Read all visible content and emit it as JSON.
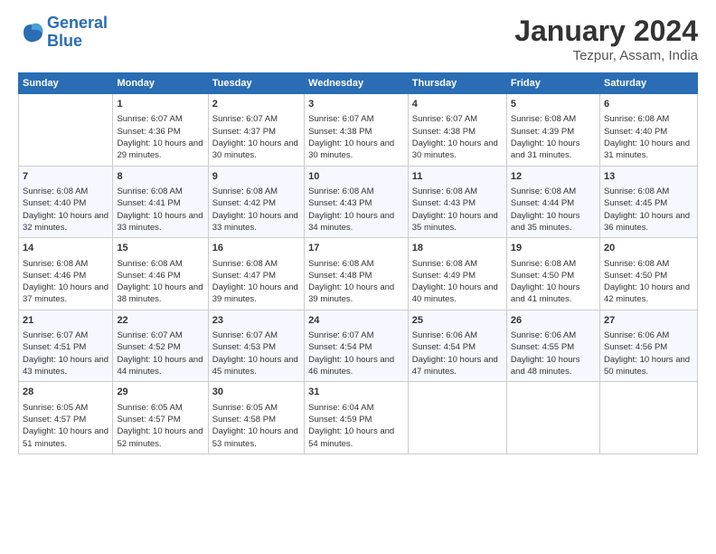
{
  "logo": {
    "line1": "General",
    "line2": "Blue"
  },
  "title": "January 2024",
  "subtitle": "Tezpur, Assam, India",
  "weekdays": [
    "Sunday",
    "Monday",
    "Tuesday",
    "Wednesday",
    "Thursday",
    "Friday",
    "Saturday"
  ],
  "weeks": [
    [
      {
        "day": "",
        "sunrise": "",
        "sunset": "",
        "daylight": ""
      },
      {
        "day": "1",
        "sunrise": "Sunrise: 6:07 AM",
        "sunset": "Sunset: 4:36 PM",
        "daylight": "Daylight: 10 hours and 29 minutes."
      },
      {
        "day": "2",
        "sunrise": "Sunrise: 6:07 AM",
        "sunset": "Sunset: 4:37 PM",
        "daylight": "Daylight: 10 hours and 30 minutes."
      },
      {
        "day": "3",
        "sunrise": "Sunrise: 6:07 AM",
        "sunset": "Sunset: 4:38 PM",
        "daylight": "Daylight: 10 hours and 30 minutes."
      },
      {
        "day": "4",
        "sunrise": "Sunrise: 6:07 AM",
        "sunset": "Sunset: 4:38 PM",
        "daylight": "Daylight: 10 hours and 30 minutes."
      },
      {
        "day": "5",
        "sunrise": "Sunrise: 6:08 AM",
        "sunset": "Sunset: 4:39 PM",
        "daylight": "Daylight: 10 hours and 31 minutes."
      },
      {
        "day": "6",
        "sunrise": "Sunrise: 6:08 AM",
        "sunset": "Sunset: 4:40 PM",
        "daylight": "Daylight: 10 hours and 31 minutes."
      }
    ],
    [
      {
        "day": "7",
        "sunrise": "Sunrise: 6:08 AM",
        "sunset": "Sunset: 4:40 PM",
        "daylight": "Daylight: 10 hours and 32 minutes."
      },
      {
        "day": "8",
        "sunrise": "Sunrise: 6:08 AM",
        "sunset": "Sunset: 4:41 PM",
        "daylight": "Daylight: 10 hours and 33 minutes."
      },
      {
        "day": "9",
        "sunrise": "Sunrise: 6:08 AM",
        "sunset": "Sunset: 4:42 PM",
        "daylight": "Daylight: 10 hours and 33 minutes."
      },
      {
        "day": "10",
        "sunrise": "Sunrise: 6:08 AM",
        "sunset": "Sunset: 4:43 PM",
        "daylight": "Daylight: 10 hours and 34 minutes."
      },
      {
        "day": "11",
        "sunrise": "Sunrise: 6:08 AM",
        "sunset": "Sunset: 4:43 PM",
        "daylight": "Daylight: 10 hours and 35 minutes."
      },
      {
        "day": "12",
        "sunrise": "Sunrise: 6:08 AM",
        "sunset": "Sunset: 4:44 PM",
        "daylight": "Daylight: 10 hours and 35 minutes."
      },
      {
        "day": "13",
        "sunrise": "Sunrise: 6:08 AM",
        "sunset": "Sunset: 4:45 PM",
        "daylight": "Daylight: 10 hours and 36 minutes."
      }
    ],
    [
      {
        "day": "14",
        "sunrise": "Sunrise: 6:08 AM",
        "sunset": "Sunset: 4:46 PM",
        "daylight": "Daylight: 10 hours and 37 minutes."
      },
      {
        "day": "15",
        "sunrise": "Sunrise: 6:08 AM",
        "sunset": "Sunset: 4:46 PM",
        "daylight": "Daylight: 10 hours and 38 minutes."
      },
      {
        "day": "16",
        "sunrise": "Sunrise: 6:08 AM",
        "sunset": "Sunset: 4:47 PM",
        "daylight": "Daylight: 10 hours and 39 minutes."
      },
      {
        "day": "17",
        "sunrise": "Sunrise: 6:08 AM",
        "sunset": "Sunset: 4:48 PM",
        "daylight": "Daylight: 10 hours and 39 minutes."
      },
      {
        "day": "18",
        "sunrise": "Sunrise: 6:08 AM",
        "sunset": "Sunset: 4:49 PM",
        "daylight": "Daylight: 10 hours and 40 minutes."
      },
      {
        "day": "19",
        "sunrise": "Sunrise: 6:08 AM",
        "sunset": "Sunset: 4:50 PM",
        "daylight": "Daylight: 10 hours and 41 minutes."
      },
      {
        "day": "20",
        "sunrise": "Sunrise: 6:08 AM",
        "sunset": "Sunset: 4:50 PM",
        "daylight": "Daylight: 10 hours and 42 minutes."
      }
    ],
    [
      {
        "day": "21",
        "sunrise": "Sunrise: 6:07 AM",
        "sunset": "Sunset: 4:51 PM",
        "daylight": "Daylight: 10 hours and 43 minutes."
      },
      {
        "day": "22",
        "sunrise": "Sunrise: 6:07 AM",
        "sunset": "Sunset: 4:52 PM",
        "daylight": "Daylight: 10 hours and 44 minutes."
      },
      {
        "day": "23",
        "sunrise": "Sunrise: 6:07 AM",
        "sunset": "Sunset: 4:53 PM",
        "daylight": "Daylight: 10 hours and 45 minutes."
      },
      {
        "day": "24",
        "sunrise": "Sunrise: 6:07 AM",
        "sunset": "Sunset: 4:54 PM",
        "daylight": "Daylight: 10 hours and 46 minutes."
      },
      {
        "day": "25",
        "sunrise": "Sunrise: 6:06 AM",
        "sunset": "Sunset: 4:54 PM",
        "daylight": "Daylight: 10 hours and 47 minutes."
      },
      {
        "day": "26",
        "sunrise": "Sunrise: 6:06 AM",
        "sunset": "Sunset: 4:55 PM",
        "daylight": "Daylight: 10 hours and 48 minutes."
      },
      {
        "day": "27",
        "sunrise": "Sunrise: 6:06 AM",
        "sunset": "Sunset: 4:56 PM",
        "daylight": "Daylight: 10 hours and 50 minutes."
      }
    ],
    [
      {
        "day": "28",
        "sunrise": "Sunrise: 6:05 AM",
        "sunset": "Sunset: 4:57 PM",
        "daylight": "Daylight: 10 hours and 51 minutes."
      },
      {
        "day": "29",
        "sunrise": "Sunrise: 6:05 AM",
        "sunset": "Sunset: 4:57 PM",
        "daylight": "Daylight: 10 hours and 52 minutes."
      },
      {
        "day": "30",
        "sunrise": "Sunrise: 6:05 AM",
        "sunset": "Sunset: 4:58 PM",
        "daylight": "Daylight: 10 hours and 53 minutes."
      },
      {
        "day": "31",
        "sunrise": "Sunrise: 6:04 AM",
        "sunset": "Sunset: 4:59 PM",
        "daylight": "Daylight: 10 hours and 54 minutes."
      },
      {
        "day": "",
        "sunrise": "",
        "sunset": "",
        "daylight": ""
      },
      {
        "day": "",
        "sunrise": "",
        "sunset": "",
        "daylight": ""
      },
      {
        "day": "",
        "sunrise": "",
        "sunset": "",
        "daylight": ""
      }
    ]
  ]
}
